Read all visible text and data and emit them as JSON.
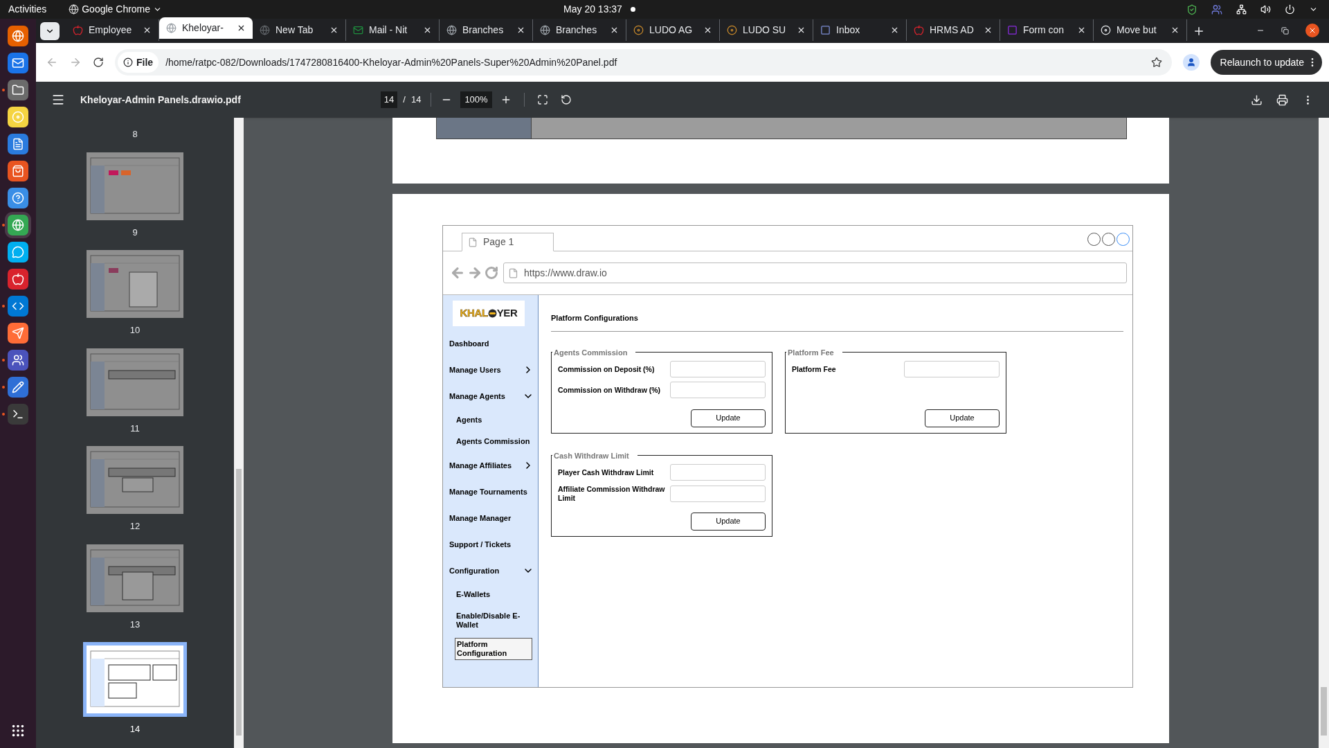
{
  "system_bar": {
    "activities": "Activities",
    "app_menu": "Google Chrome",
    "clock": "May 20  13:37"
  },
  "dock": [
    {
      "running": false
    },
    {
      "running": false
    },
    {
      "running": true
    },
    {
      "running": false
    },
    {
      "running": false
    },
    {
      "running": false
    },
    {
      "running": false
    },
    {
      "running": true
    },
    {
      "running": false
    },
    {
      "running": false
    },
    {
      "running": true
    },
    {
      "running": false
    },
    {
      "running": true
    },
    {
      "running": true
    },
    {
      "running": true
    }
  ],
  "tabs": [
    {
      "title": "Employee",
      "selected": false
    },
    {
      "title": "Kheloyar-",
      "selected": true
    },
    {
      "title": "New Tab",
      "selected": false
    },
    {
      "title": "Mail - Nit",
      "selected": false
    },
    {
      "title": "Branches",
      "selected": false
    },
    {
      "title": "Branches",
      "selected": false
    },
    {
      "title": "LUDO AG",
      "selected": false
    },
    {
      "title": "LUDO SU",
      "selected": false
    },
    {
      "title": "Inbox",
      "selected": false
    },
    {
      "title": "HRMS AD",
      "selected": false
    },
    {
      "title": "Form con",
      "selected": false
    },
    {
      "title": "Move but",
      "selected": false
    }
  ],
  "address_bar": {
    "scheme": "File",
    "url": "/home/ratpc-082/Downloads/1747280816400-Kheloyar-Admin%20Panels-Super%20Admin%20Panel.pdf"
  },
  "relaunch_button": "Relaunch to update",
  "pdf_toolbar": {
    "file_name": "Kheloyar-Admin Panels.drawio.pdf",
    "page": "14",
    "page_separator": "/",
    "page_count": "14",
    "zoom": "100%"
  },
  "thumbnails": [
    {
      "label": "8",
      "kind": "label_only",
      "selected": false
    },
    {
      "label": "9",
      "kind": "page",
      "selected": false
    },
    {
      "label": "10",
      "kind": "page",
      "selected": false
    },
    {
      "label": "11",
      "kind": "page",
      "selected": false
    },
    {
      "label": "12",
      "kind": "page",
      "selected": false
    },
    {
      "label": "13",
      "kind": "page",
      "selected": false
    },
    {
      "label": "14",
      "kind": "page",
      "selected": true
    }
  ],
  "mockup": {
    "tab": "Page 1",
    "url": "https://www.draw.io",
    "logo": {
      "left": "KHAL",
      "right": "YER"
    },
    "sidebar": [
      {
        "label": "Dashboard"
      },
      {
        "label": "Manage Users",
        "expanded": false
      },
      {
        "label": "Manage Agents",
        "expanded": true,
        "children": [
          {
            "label": "Agents",
            "selected": false
          },
          {
            "label": "Agents Commission",
            "selected": false
          }
        ]
      },
      {
        "label": "Manage Affiliates",
        "expanded": false
      },
      {
        "label": "Manage Tournaments"
      },
      {
        "label": "Manage Manager"
      },
      {
        "label": "Support / Tickets"
      },
      {
        "label": "Configuration",
        "expanded": true,
        "children": [
          {
            "label": "E-Wallets",
            "selected": false
          },
          {
            "label": "Enable/Disable E-Wallet",
            "selected": false
          },
          {
            "label": "Platform Configuration",
            "selected": true
          }
        ]
      }
    ],
    "title": "Platform Configurations",
    "groups": [
      {
        "legend": "Agents Commission",
        "fields": [
          "Commission on Deposit (%)",
          "Commission on Withdraw (%)"
        ],
        "button": "Update"
      },
      {
        "legend": "Platform Fee",
        "fields": [
          "Platform Fee"
        ],
        "button": "Update"
      },
      {
        "legend": "Cash Withdraw Limit",
        "fields": [
          "Player Cash Withdraw Limit",
          "Affiliate Commission Withdraw Limit"
        ],
        "button": "Update"
      }
    ]
  }
}
